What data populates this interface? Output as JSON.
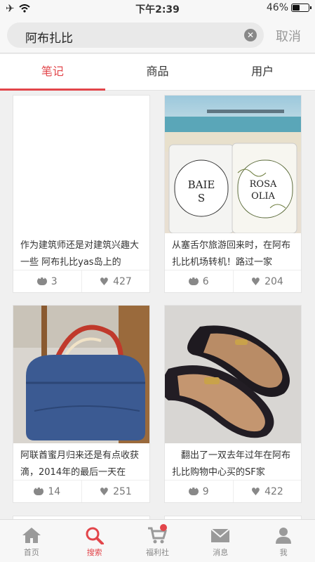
{
  "status": {
    "time": "下午2:39",
    "battery": "46%",
    "battery_level": 0.46
  },
  "search": {
    "query": "阿布扎比",
    "cancel_label": "取消"
  },
  "tabs": [
    {
      "label": "笔记",
      "active": true
    },
    {
      "label": "商品",
      "active": false
    },
    {
      "label": "用户",
      "active": false
    }
  ],
  "cards": [
    {
      "text": "作为建筑师还是对建筑兴趣大一些 阿布扎比yas岛上的",
      "comments": "3",
      "likes": "427"
    },
    {
      "text": "从塞舌尔旅游回来时，在阿布扎比机场转机！路过一家",
      "comments": "6",
      "likes": "204",
      "candle_labels": [
        "BAIES",
        "ROSAOLIA"
      ]
    },
    {
      "text": "阿联酋蜜月归来还是有点收获滴，2014年的最后一天在",
      "comments": "14",
      "likes": "251"
    },
    {
      "text": "　翻出了一双去年过年在阿布扎比购物中心买的SF家",
      "comments": "9",
      "likes": "422"
    }
  ],
  "nav": [
    {
      "label": "首页",
      "icon": "home-icon",
      "active": false
    },
    {
      "label": "搜索",
      "icon": "search-icon",
      "active": true
    },
    {
      "label": "福利社",
      "icon": "cart-icon",
      "active": false,
      "badge": true
    },
    {
      "label": "消息",
      "icon": "envelope-icon",
      "active": false
    },
    {
      "label": "我",
      "icon": "person-icon",
      "active": false
    }
  ],
  "colors": {
    "accent": "#e2454a",
    "background": "#f0f0f0"
  }
}
